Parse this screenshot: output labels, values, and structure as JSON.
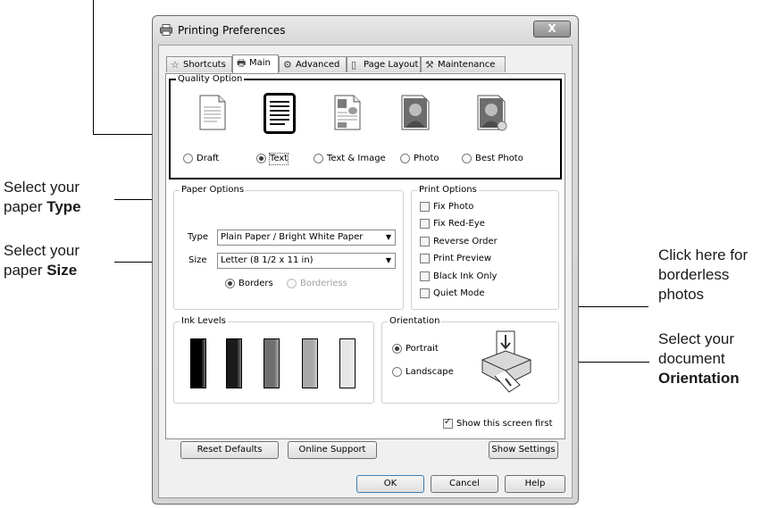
{
  "callouts": {
    "type_line1": "Select your",
    "type_line2_pre": "paper ",
    "type_line2_bold": "Type",
    "size_line1": "Select your",
    "size_line2_pre": "paper ",
    "size_line2_bold": "Size",
    "borderless_line1": "Click here for",
    "borderless_line2": "borderless",
    "borderless_line3": "photos",
    "orient_line1": "Select your",
    "orient_line2": "document",
    "orient_line3_bold": "Orientation"
  },
  "window": {
    "title": "Printing Preferences",
    "close": "X"
  },
  "tabs": [
    {
      "label": "Shortcuts",
      "icon": "star-icon"
    },
    {
      "label": "Main",
      "icon": "printer-icon"
    },
    {
      "label": "Advanced",
      "icon": "gear-icon"
    },
    {
      "label": "Page Layout",
      "icon": "page-icon"
    },
    {
      "label": "Maintenance",
      "icon": "wrench-icon"
    }
  ],
  "quality": {
    "legend": "Quality Option",
    "options": [
      "Draft",
      "Text",
      "Text & Image",
      "Photo",
      "Best Photo"
    ],
    "selected": "Text"
  },
  "paper": {
    "legend": "Paper Options",
    "type_label": "Type",
    "type_value": "Plain Paper / Bright White Paper",
    "size_label": "Size",
    "size_value": "Letter (8 1/2 x 11 in)",
    "borders": "Borders",
    "borderless": "Borderless",
    "selected": "Borders"
  },
  "print_options": {
    "legend": "Print Options",
    "items": [
      "Fix Photo",
      "Fix Red-Eye",
      "Reverse Order",
      "Print Preview",
      "Black Ink Only",
      "Quiet Mode"
    ]
  },
  "ink": {
    "legend": "Ink Levels",
    "colors": [
      "#000000",
      "#1a1a1a",
      "#6e6e6e",
      "#a9a9a9",
      "#e6e6e6"
    ]
  },
  "orientation": {
    "legend": "Orientation",
    "portrait": "Portrait",
    "landscape": "Landscape",
    "selected": "Portrait"
  },
  "show_screen_first": {
    "label": "Show this screen first",
    "checked": true
  },
  "buttons": {
    "reset": "Reset Defaults",
    "online": "Online Support",
    "show_settings": "Show Settings",
    "ok": "OK",
    "cancel": "Cancel",
    "help": "Help"
  }
}
